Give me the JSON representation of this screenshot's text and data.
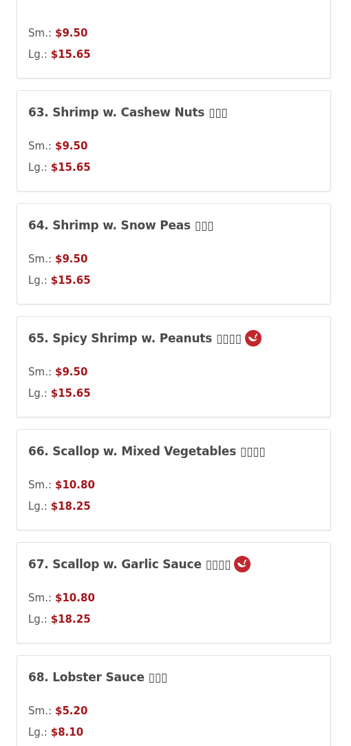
{
  "items": [
    {
      "spicy": false,
      "prices": [
        {
          "label": "Sm.:",
          "price": "$9.50"
        },
        {
          "label": "Lg.:",
          "price": "$15.65"
        }
      ]
    },
    {
      "title": "63. Shrimp w. Cashew Nuts ▯▯▯",
      "spicy": false,
      "prices": [
        {
          "label": "Sm.:",
          "price": "$9.50"
        },
        {
          "label": "Lg.:",
          "price": "$15.65"
        }
      ]
    },
    {
      "title": "64. Shrimp w. Snow Peas ▯▯▯",
      "spicy": false,
      "prices": [
        {
          "label": "Sm.:",
          "price": "$9.50"
        },
        {
          "label": "Lg.:",
          "price": "$15.65"
        }
      ]
    },
    {
      "title": "65. Spicy Shrimp w. Peanuts ▯▯▯▯",
      "spicy": true,
      "prices": [
        {
          "label": "Sm.:",
          "price": "$9.50"
        },
        {
          "label": "Lg.:",
          "price": "$15.65"
        }
      ]
    },
    {
      "title": "66. Scallop w. Mixed Vegetables ▯▯▯▯",
      "spicy": false,
      "prices": [
        {
          "label": "Sm.:",
          "price": "$10.80"
        },
        {
          "label": "Lg.:",
          "price": "$18.25"
        }
      ]
    },
    {
      "title": "67. Scallop w. Garlic Sauce ▯▯▯▯",
      "spicy": true,
      "prices": [
        {
          "label": "Sm.:",
          "price": "$10.80"
        },
        {
          "label": "Lg.:",
          "price": "$18.25"
        }
      ]
    },
    {
      "title": "68. Lobster Sauce ▯▯▯",
      "spicy": false,
      "prices": [
        {
          "label": "Sm.:",
          "price": "$5.20"
        },
        {
          "label": "Lg.:",
          "price": "$8.10"
        }
      ]
    }
  ]
}
